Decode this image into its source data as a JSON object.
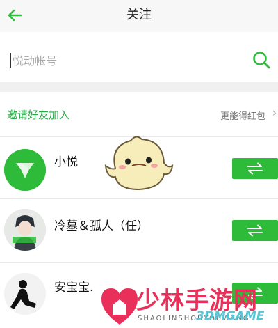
{
  "header": {
    "title": "关注",
    "back_icon": "arrow-left-icon"
  },
  "search": {
    "placeholder": "悦动帐号",
    "icon": "search-icon"
  },
  "invite": {
    "title": "邀请好友加入",
    "hint": "更能得红包",
    "chevron": "›"
  },
  "users": [
    {
      "name": "小悦",
      "avatar": "yuedong-logo"
    },
    {
      "name": "冷墓＆孤人（任）",
      "avatar": "anime-boy-photo"
    },
    {
      "name": "安宝宝.",
      "avatar": "silhouette-photo"
    }
  ],
  "follow_button_icon": "swap-arrows-icon",
  "watermark": {
    "text": "少林手游网",
    "sub": "SHAOLINSHOUYOUWANG",
    "brand": "3DMGAME"
  },
  "colors": {
    "accent": "#2fbb3a",
    "invite_text": "#27a844",
    "watermark": "#e8305a"
  }
}
